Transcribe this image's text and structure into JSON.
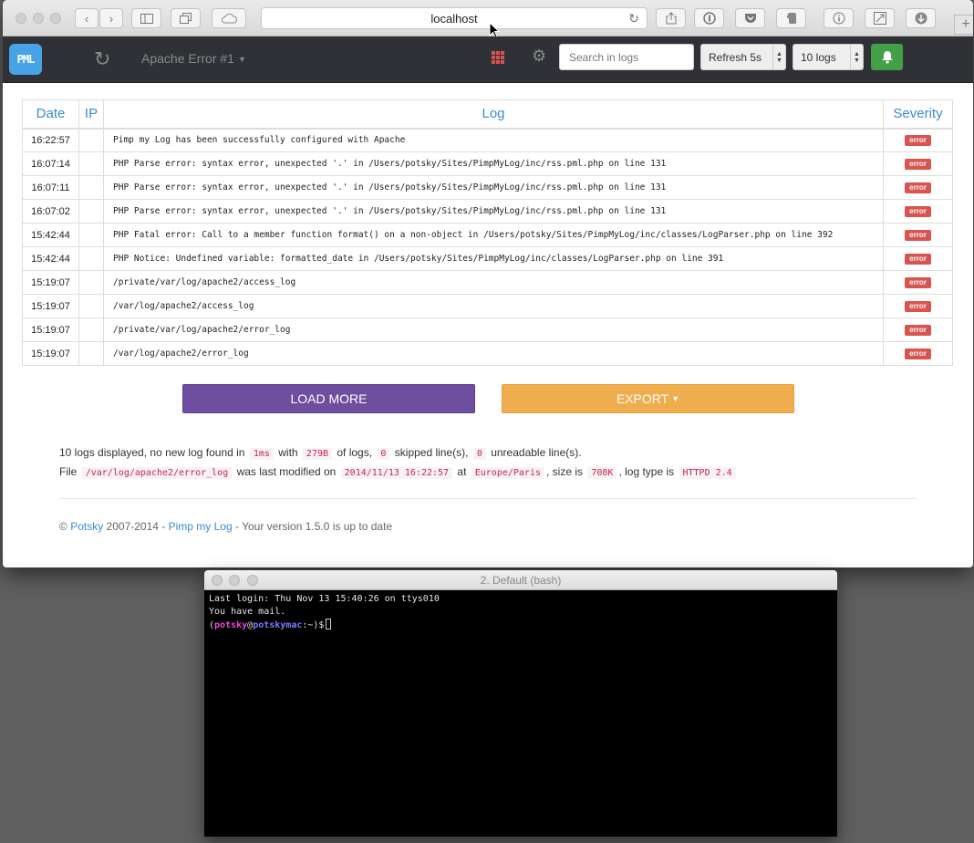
{
  "browser": {
    "url": "localhost",
    "back_icon": "‹",
    "forward_icon": "›",
    "newtab_icon": "+"
  },
  "navbar": {
    "logo_text": "PML",
    "current_file": "Apache Error #1",
    "search_placeholder": "Search in logs",
    "refresh_select": "Refresh 5s",
    "count_select": "10 logs"
  },
  "table": {
    "headers": {
      "date": "Date",
      "ip": "IP",
      "log": "Log",
      "severity": "Severity"
    },
    "rows": [
      {
        "date": "16:22:57",
        "ip": "",
        "log": "Pimp my Log has been successfully configured with Apache",
        "severity": "error"
      },
      {
        "date": "16:07:14",
        "ip": "",
        "log": "PHP Parse error:  syntax error, unexpected '.' in /Users/potsky/Sites/PimpMyLog/inc/rss.pml.php on line 131",
        "severity": "error"
      },
      {
        "date": "16:07:11",
        "ip": "",
        "log": "PHP Parse error:  syntax error, unexpected '.' in /Users/potsky/Sites/PimpMyLog/inc/rss.pml.php on line 131",
        "severity": "error"
      },
      {
        "date": "16:07:02",
        "ip": "",
        "log": "PHP Parse error:  syntax error, unexpected '.' in /Users/potsky/Sites/PimpMyLog/inc/rss.pml.php on line 131",
        "severity": "error"
      },
      {
        "date": "15:42:44",
        "ip": "",
        "log": "PHP Fatal error:  Call to a member function format() on a non-object in /Users/potsky/Sites/PimpMyLog/inc/classes/LogParser.php on line 392",
        "severity": "error"
      },
      {
        "date": "15:42:44",
        "ip": "",
        "log": "PHP Notice:  Undefined variable: formatted_date in /Users/potsky/Sites/PimpMyLog/inc/classes/LogParser.php on line 391",
        "severity": "error"
      },
      {
        "date": "15:19:07",
        "ip": "",
        "log": "/private/var/log/apache2/access_log",
        "severity": "error"
      },
      {
        "date": "15:19:07",
        "ip": "",
        "log": "/var/log/apache2/access_log",
        "severity": "error"
      },
      {
        "date": "15:19:07",
        "ip": "",
        "log": "/private/var/log/apache2/error_log",
        "severity": "error"
      },
      {
        "date": "15:19:07",
        "ip": "",
        "log": "/var/log/apache2/error_log",
        "severity": "error"
      }
    ]
  },
  "actions": {
    "load_more": "LOAD MORE",
    "export": "EXPORT"
  },
  "info": {
    "line1": {
      "t1": "10 logs displayed, no new log found in",
      "time": "1ms",
      "t2": "with",
      "size": "279B",
      "t3": "of logs,",
      "skipped": "0",
      "t4": "skipped line(s),",
      "unreadable": "0",
      "t5": "unreadable line(s)."
    },
    "line2": {
      "t1": "File",
      "path": "/var/log/apache2/error_log",
      "t2": "was last modified on",
      "modified": "2014/11/13 16:22:57",
      "t3": "at",
      "timezone": "Europe/Paris",
      "t4": ", size is",
      "filesize": "708K",
      "t5": ", log type is",
      "logtype": "HTTPD 2.4"
    }
  },
  "footer": {
    "copy_symbol": "©",
    "author": "Potsky",
    "years": "2007-2014 -",
    "product": "Pimp my Log",
    "version_text": "- Your version 1.5.0 is up to date"
  },
  "terminal": {
    "title": "2. Default (bash)",
    "line1": "Last login: Thu Nov 13 15:40:26 on ttys010",
    "line2": "You have mail.",
    "prompt_open": "(",
    "prompt_user": "potsky",
    "prompt_at": "@",
    "prompt_host": "potskymac",
    "prompt_close": ":~)$"
  },
  "colors": {
    "accent": "#3a8ad0",
    "error_badge": "#d9534f",
    "load_more": "#6e4e9e",
    "export": "#f0ad4e",
    "notify": "#43a047"
  }
}
